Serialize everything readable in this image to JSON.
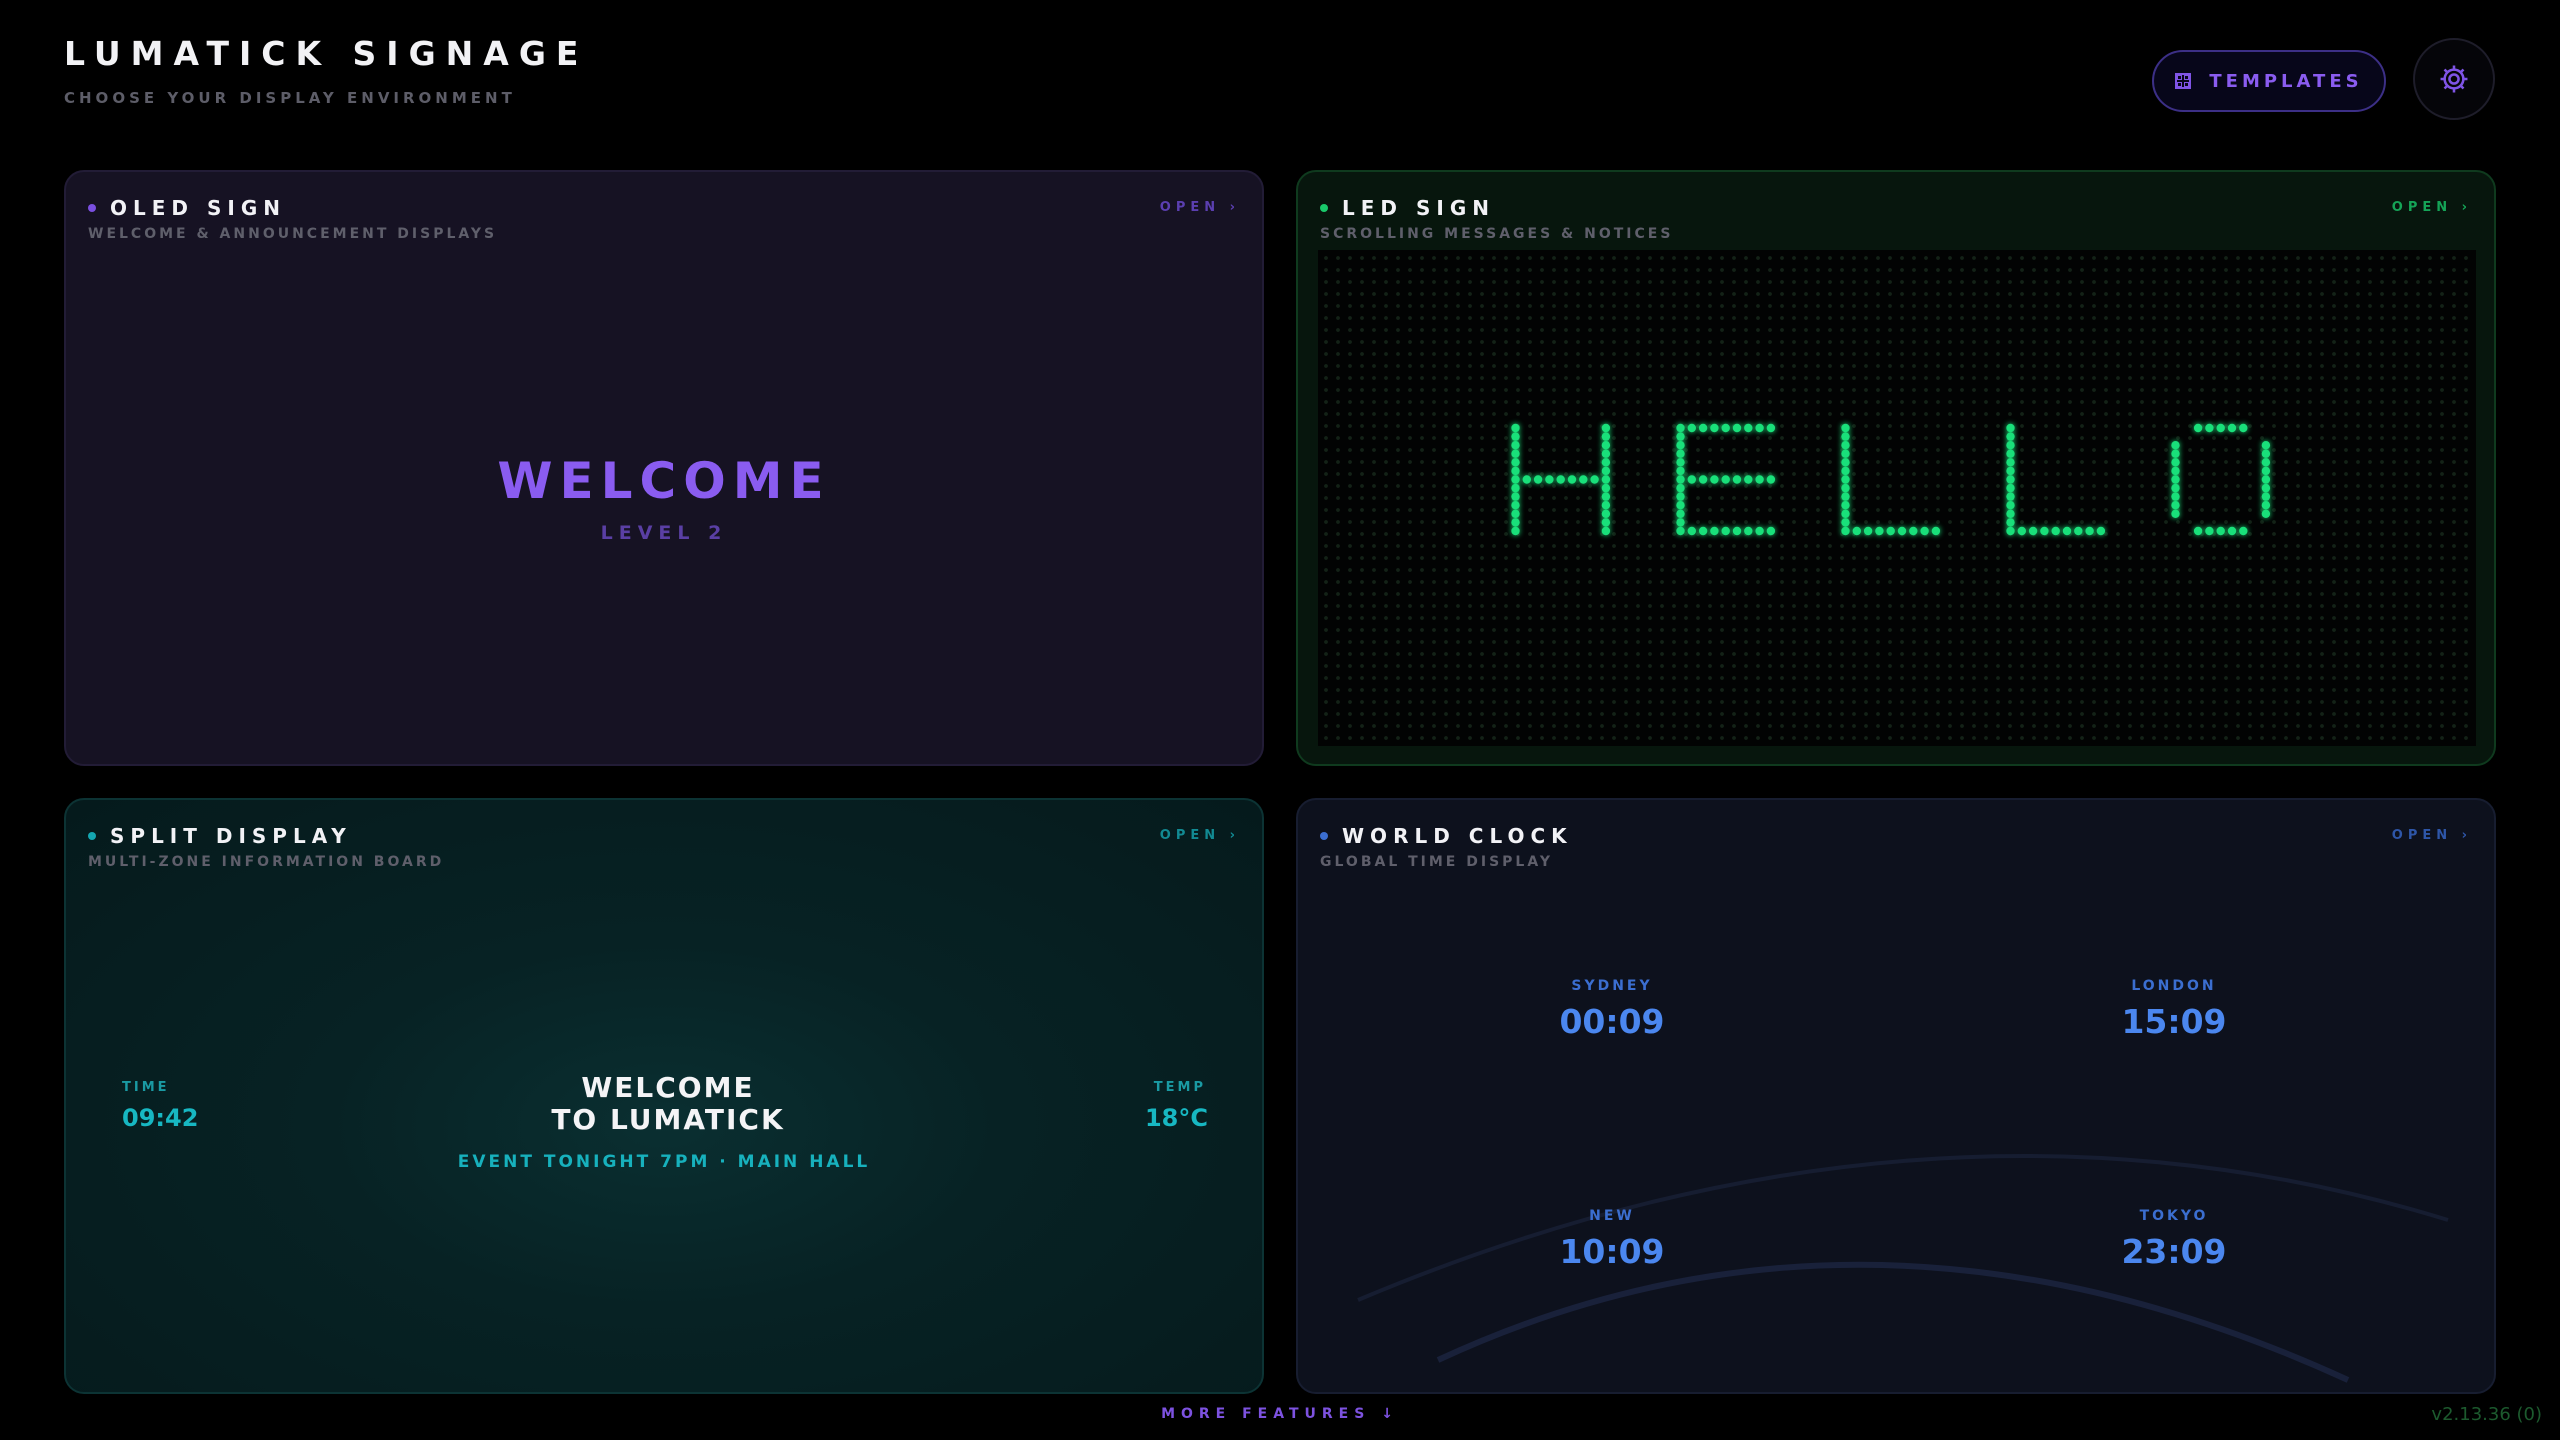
{
  "header": {
    "title": "LUMATICK SIGNAGE",
    "subtitle": "CHOOSE YOUR DISPLAY ENVIRONMENT",
    "templates_label": "TEMPLATES"
  },
  "colors": {
    "accent_purple": "#8a5cf0",
    "led_green": "#19e07a",
    "split_teal": "#17b7c2",
    "clock_blue": "#4b87ef"
  },
  "icons": {
    "templates": "grid-icon",
    "settings": "gear-icon",
    "more": "arrow-down-icon"
  },
  "cards": {
    "oled": {
      "title": "OLED SIGN",
      "subtitle": "WELCOME & ANNOUNCEMENT DISPLAYS",
      "open": "OPEN ›",
      "preview_title": "WELCOME",
      "preview_sub": "LEVEL 2"
    },
    "led": {
      "title": "LED SIGN",
      "subtitle": "SCROLLING MESSAGES & NOTICES",
      "open": "OPEN ›",
      "message": "HELLO"
    },
    "split": {
      "title": "SPLIT DISPLAY",
      "subtitle": "MULTI-ZONE INFORMATION BOARD",
      "open": "OPEN ›",
      "left_label": "TIME",
      "left_value": "09:42",
      "right_label": "TEMP",
      "right_value": "18°C",
      "main_line1": "WELCOME",
      "main_line2": "TO LUMATICK",
      "event": "EVENT TONIGHT 7PM · MAIN HALL"
    },
    "clock": {
      "title": "WORLD CLOCK",
      "subtitle": "GLOBAL TIME DISPLAY",
      "open": "OPEN ›",
      "cities": [
        {
          "name": "SYDNEY",
          "time": "00:09"
        },
        {
          "name": "LONDON",
          "time": "15:09"
        },
        {
          "name": "NEW",
          "time": "10:09"
        },
        {
          "name": "TOKYO",
          "time": "23:09"
        }
      ]
    }
  },
  "footer": {
    "more_features": "MORE FEATURES ↓",
    "version": "v2.13.36 (0)"
  }
}
